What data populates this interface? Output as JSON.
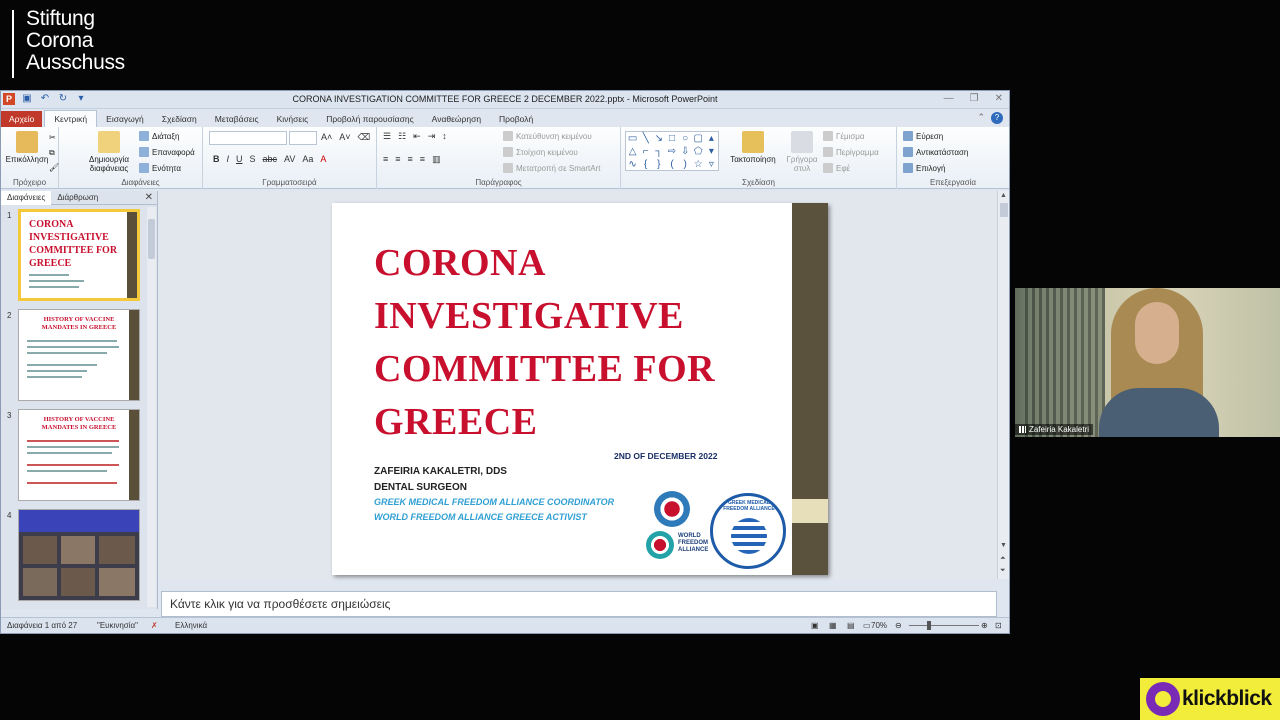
{
  "overlay": {
    "line1": "Stiftung",
    "line2": "Corona",
    "line3": "Ausschuss"
  },
  "window": {
    "title": "CORONA INVESTIGATION COMMITTEE FOR GREECE 2 DECEMBER 2022.pptx - Microsoft PowerPoint",
    "app_icon": "P"
  },
  "tabs": [
    "Αρχείο",
    "Κεντρική",
    "Εισαγωγή",
    "Σχεδίαση",
    "Μεταβάσεις",
    "Κινήσεις",
    "Προβολή παρουσίασης",
    "Αναθεώρηση",
    "Προβολή"
  ],
  "ribbon": {
    "clipboard": {
      "paste": "Επικόλληση",
      "group": "Πρόχειρο"
    },
    "slides": {
      "new_slide_1": "Δημιουργία",
      "new_slide_2": "διαφάνειας",
      "layout": "Διάταξη",
      "reset": "Επαναφορά",
      "section": "Ενότητα",
      "group": "Διαφάνειες"
    },
    "font": {
      "group": "Γραμματοσειρά"
    },
    "paragraph": {
      "text_direction": "Κατεύθυνση κειμένου",
      "align_text": "Στοίχιση κειμένου",
      "smartart": "Μετατροπή σε SmartArt",
      "group": "Παράγραφος"
    },
    "drawing": {
      "arrange": "Τακτοποίηση",
      "quick_styles_1": "Γρήγορα",
      "quick_styles_2": "στυλ",
      "fill": "Γέμισμα",
      "outline": "Περίγραμμα",
      "effects": "Εφέ",
      "group": "Σχεδίαση"
    },
    "editing": {
      "find": "Εύρεση",
      "replace": "Αντικατάσταση",
      "select": "Επιλογή",
      "group": "Επεξεργασία"
    }
  },
  "left_pane": {
    "tab_slides": "Διαφάνειες",
    "tab_outline": "Διάρθρωση",
    "thumbs": [
      {
        "num": "1",
        "title": "CORONA INVESTIGATIVE COMMITTEE FOR GREECE"
      },
      {
        "num": "2",
        "title": "HISTORY OF VACCINE MANDATES IN GREECE"
      },
      {
        "num": "3",
        "title": "HISTORY OF VACCINE MANDATES IN GREECE"
      },
      {
        "num": "4",
        "title": ""
      }
    ]
  },
  "slide": {
    "title_l1": "CORONA",
    "title_l2": "INVESTIGATIVE",
    "title_l3": "COMMITTEE FOR",
    "title_l4": "GREECE",
    "date": "2ND OF DECEMBER 2022",
    "name": "ZAFEIRIA KAKALETRI, DDS",
    "profession": "DENTAL SURGEON",
    "role1": "GREEK MEDICAL FREEDOM ALLIANCE COORDINATOR",
    "role2": "WORLD FREEDOM ALLIANCE GREECE ACTIVIST",
    "wfa_l1": "WORLD",
    "wfa_l2": "FREEDOM",
    "wfa_l3": "ALLIANCE",
    "gmfa_text": "GREEK MEDICAL FREEDOM ALLIANCE"
  },
  "notes_placeholder": "Κάντε κλικ για να προσθέσετε σημειώσεις",
  "status": {
    "slide_info": "Διαφάνεια 1 από 27",
    "theme": "\"Ευκινησία\"",
    "language": "Ελληνικά",
    "zoom": "70%"
  },
  "webcam": {
    "name": "Zafeiria Kakaletri"
  },
  "badge": {
    "text": "klickblick"
  },
  "colors": {
    "slide_title": "#c8102e",
    "accent_band": "#5b523d",
    "file_tab": "#c0392b",
    "badge_bg": "#f2ec3a"
  }
}
